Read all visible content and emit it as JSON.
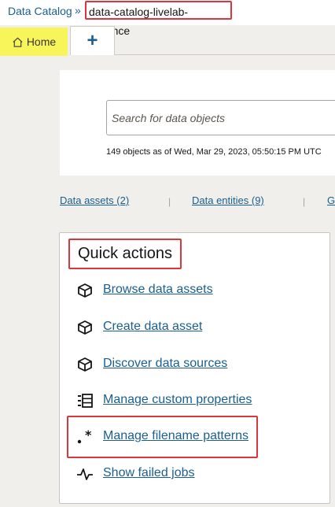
{
  "breadcrumb": {
    "root": "Data Catalog",
    "separator": "»",
    "current": "data-catalog-livelab-instance"
  },
  "tabs": {
    "home_label": "Home",
    "add_label": "+"
  },
  "search": {
    "placeholder": "Search for data objects",
    "object_count": "149 objects as of Wed, Mar 29, 2023, 05:50:15 PM UTC"
  },
  "links": {
    "data_assets": "Data assets (2)",
    "data_entities": "Data entities (9)",
    "glossary_partial": "G",
    "divider": "|"
  },
  "quick_actions": {
    "title": "Quick actions",
    "items": [
      {
        "label": "Browse data assets",
        "icon": "cube-icon"
      },
      {
        "label": "Create data asset",
        "icon": "cube-icon"
      },
      {
        "label": "Discover data sources",
        "icon": "cube-icon"
      },
      {
        "label": "Manage custom properties",
        "icon": "list-properties-icon"
      },
      {
        "label": "Manage filename patterns",
        "icon": "filename-pattern-icon"
      },
      {
        "label": "Show failed jobs",
        "icon": "pulse-icon"
      }
    ]
  },
  "colors": {
    "link": "#1a5f8e",
    "highlight_border": "#d9363e",
    "home_tab_highlight": "#f8f55a"
  }
}
